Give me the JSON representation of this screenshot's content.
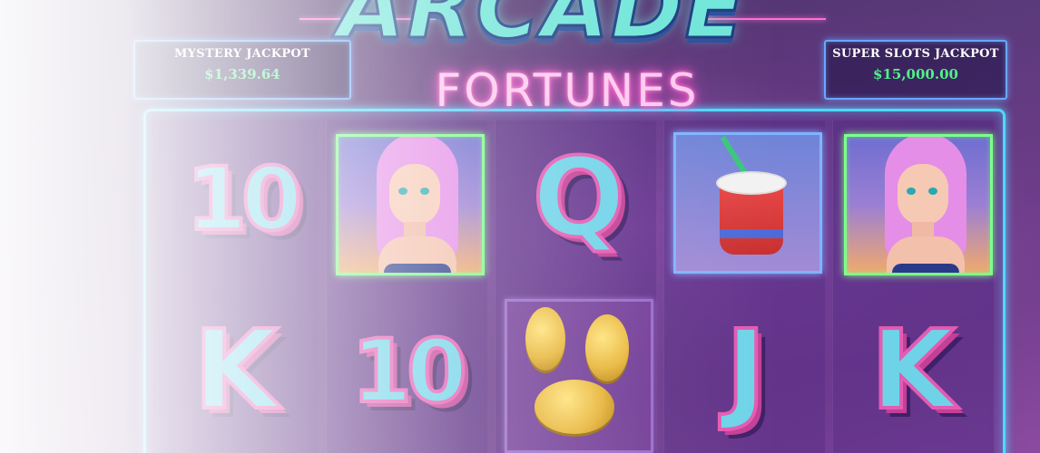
{
  "game": {
    "title_line1": "ARCADE",
    "title_line2": "FORTUNES"
  },
  "jackpots": {
    "mystery": {
      "label": "MYSTERY JACKPOT",
      "value": "$1,339.64"
    },
    "super_slots": {
      "label": "SUPER SLOTS JACKPOT",
      "value": "$15,000.00"
    }
  },
  "reels": {
    "row1": [
      "10",
      "girl-icon",
      "Q",
      "drink-icon",
      "girl-icon"
    ],
    "row2": [
      "K",
      "10",
      "coins-icon",
      "J",
      "K"
    ]
  },
  "colors": {
    "neon_blue": "#4fd7ff",
    "neon_pink": "#ff6fd1",
    "neon_green": "#7dff8a",
    "jackpot_value": "#4ff08a"
  }
}
